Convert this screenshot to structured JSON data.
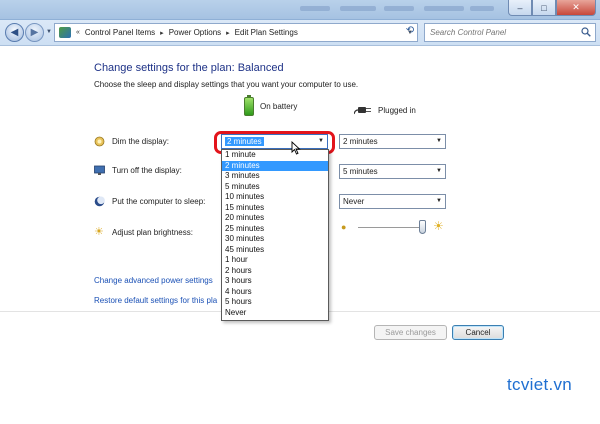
{
  "window": {
    "controls": {
      "minimize": "–",
      "maximize": "□",
      "close": "✕"
    }
  },
  "nav": {
    "breadcrumb": [
      "Control Panel Items",
      "Power Options",
      "Edit Plan Settings"
    ],
    "crumb_lead": "«",
    "crumb_separator": "▸",
    "search_placeholder": "Search Control Panel"
  },
  "page": {
    "title": "Change settings for the plan: Balanced",
    "subtitle": "Choose the sleep and display settings that you want your computer to use.",
    "col_battery": "On battery",
    "col_plugged": "Plugged in",
    "rows": {
      "dim": {
        "label": "Dim the display:",
        "battery": "2 minutes",
        "plugged": "2 minutes"
      },
      "off": {
        "label": "Turn off the display:",
        "plugged": "5 minutes"
      },
      "sleep": {
        "label": "Put the computer to sleep:",
        "plugged": "Never"
      },
      "brightness": {
        "label": "Adjust plan brightness:",
        "plugged_level": 1.0
      }
    },
    "dropdown_options": [
      "1 minute",
      "2 minutes",
      "3 minutes",
      "5 minutes",
      "10 minutes",
      "15 minutes",
      "20 minutes",
      "25 minutes",
      "30 minutes",
      "45 minutes",
      "1 hour",
      "2 hours",
      "3 hours",
      "4 hours",
      "5 hours",
      "Never"
    ],
    "selected_option": "2 minutes",
    "link_advanced": "Change advanced power settings",
    "link_restore": "Restore default settings for this pla",
    "btn_save": "Save changes",
    "btn_cancel": "Cancel"
  },
  "watermark": "tcviet.vn",
  "colors": {
    "highlight_ring": "#e3141b",
    "selection": "#3399ff",
    "heading": "#1e3287",
    "link": "#1a50b5"
  }
}
